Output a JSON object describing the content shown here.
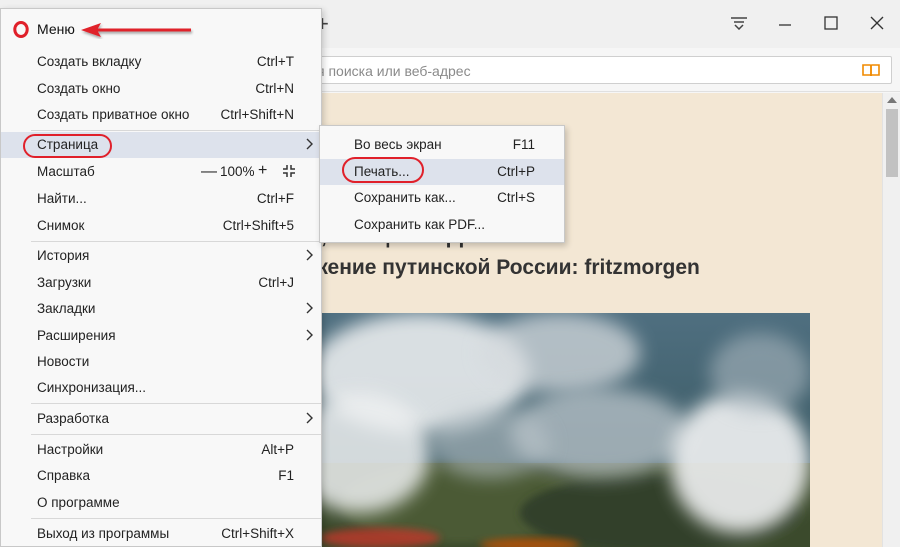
{
  "menu": {
    "title": "Меню",
    "items": [
      {
        "label": "Создать вкладку",
        "shortcut": "Ctrl+T"
      },
      {
        "label": "Создать окно",
        "shortcut": "Ctrl+N"
      },
      {
        "label": "Создать приватное окно",
        "shortcut": "Ctrl+Shift+N"
      },
      {
        "label": "Страница",
        "shortcut": ""
      },
      {
        "label": "Масштаб",
        "shortcut": ""
      },
      {
        "label": "Найти...",
        "shortcut": "Ctrl+F"
      },
      {
        "label": "Снимок",
        "shortcut": "Ctrl+Shift+5"
      },
      {
        "label": "История",
        "shortcut": ""
      },
      {
        "label": "Загрузки",
        "shortcut": "Ctrl+J"
      },
      {
        "label": "Закладки",
        "shortcut": ""
      },
      {
        "label": "Расширения",
        "shortcut": ""
      },
      {
        "label": "Новости",
        "shortcut": ""
      },
      {
        "label": "Синхронизация...",
        "shortcut": ""
      },
      {
        "label": "Разработка",
        "shortcut": ""
      },
      {
        "label": "Настройки",
        "shortcut": "Alt+P"
      },
      {
        "label": "Справка",
        "shortcut": "F1"
      },
      {
        "label": "О программе",
        "shortcut": ""
      },
      {
        "label": "Выход из программы",
        "shortcut": "Ctrl+Shift+X"
      }
    ],
    "zoom": {
      "minus": "—",
      "value": "100%",
      "plus": "+"
    }
  },
  "submenu": {
    "items": [
      {
        "label": "Во весь экран",
        "shortcut": "F11"
      },
      {
        "label": "Печать...",
        "shortcut": "Ctrl+P"
      },
      {
        "label": "Сохранить как...",
        "shortcut": "Ctrl+S"
      },
      {
        "label": "Сохранить как PDF...",
        "shortcut": ""
      }
    ]
  },
  "toolbar": {
    "new_tab": "+",
    "address_placeholder": "я поиска или веб-адрес"
  },
  "article": {
    "headline_line1": "…, …ющий баррель и",
    "headline_line2": "ижение путинской России: fritzmorgen"
  },
  "icons": {
    "opera": "opera-logo-icon",
    "arrow": "red-arrow-icon",
    "chevron": "chevron-right-icon",
    "fullscreen": "fullscreen-icon",
    "reader": "reader-mode-icon",
    "tabs_menu": "tabs-menu-icon",
    "minimize": "minimize-icon",
    "maximize": "maximize-icon",
    "close": "close-icon"
  },
  "colors": {
    "highlight_ring": "#e0202a",
    "opera_red": "#e0202a",
    "page_background": "#f3e7d4",
    "menu_hover": "#dde2ec",
    "reader_icon": "#f08a00"
  }
}
